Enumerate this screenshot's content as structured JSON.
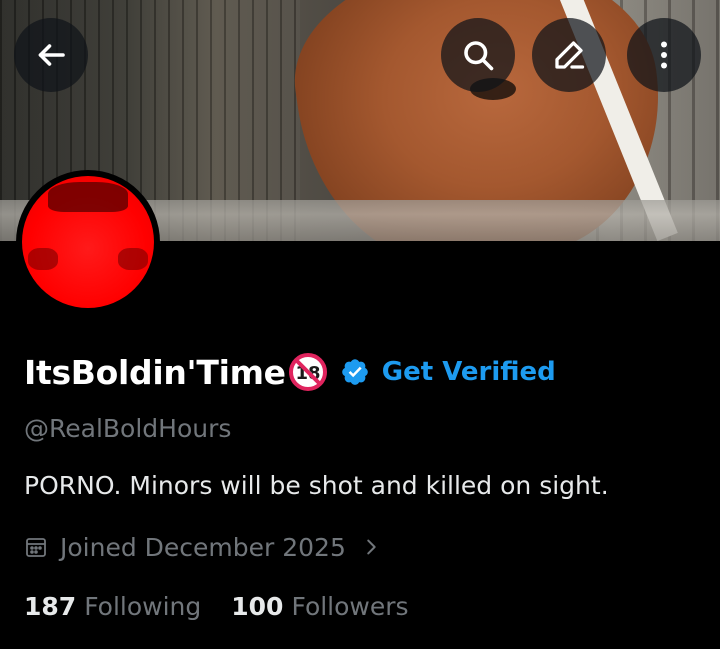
{
  "header": {
    "back_icon": "arrow-left-icon",
    "search_icon": "search-icon",
    "edit_icon": "pencil-icon",
    "more_icon": "more-vertical-icon"
  },
  "profile": {
    "display_name": "ItsBoldin'Time",
    "name_emoji": "no-one-under-18-icon",
    "verified_badge": "verified-badge-icon",
    "get_verified_label": "Get Verified",
    "handle": "@RealBoldHours",
    "bio": "PORNO. Minors will be shot and killed on sight.",
    "joined": "Joined December 2025",
    "following_count": "187",
    "following_label": "Following",
    "followers_count": "100",
    "followers_label": "Followers"
  },
  "colors": {
    "background": "#000000",
    "accent": "#1d9bf0",
    "secondary_text": "#71767b",
    "primary_text": "#e7e9ea",
    "avatar": "#ff0000"
  }
}
